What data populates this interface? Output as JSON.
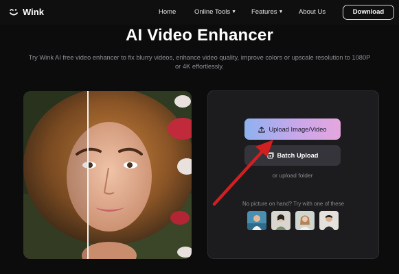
{
  "nav": {
    "logo_text": "Wink",
    "links": [
      {
        "label": "Home",
        "dropdown": false
      },
      {
        "label": "Online Tools",
        "dropdown": true
      },
      {
        "label": "Features",
        "dropdown": true
      },
      {
        "label": "About Us",
        "dropdown": false
      }
    ],
    "download_label": "Download"
  },
  "hero": {
    "title": "AI Video Enhancer",
    "subtitle": "Try Wink AI free video enhancer to fix blurry videos, enhance video quality, improve colors or upscale resolution to 1080P or 4K effortlessly."
  },
  "uploader": {
    "upload_label": "Upload Image/Video",
    "batch_label": "Batch Upload",
    "folder_link": "or upload folder",
    "sample_hint": "No picture on hand? Try with one of these",
    "samples": [
      "sample-photo-1",
      "sample-photo-2",
      "sample-photo-3",
      "sample-photo-4"
    ]
  },
  "colors": {
    "background": "#0c0c0d",
    "panel": "#1c1c1f",
    "upload_gradient_start": "#8fb1ef",
    "upload_gradient_end": "#e5a6de",
    "annotation_arrow": "#d21f1f"
  },
  "icons": {
    "logo": "wink-smile-icon",
    "upload": "upload-icon",
    "batch": "batch-icon",
    "annotation": "red-arrow-annotation"
  }
}
